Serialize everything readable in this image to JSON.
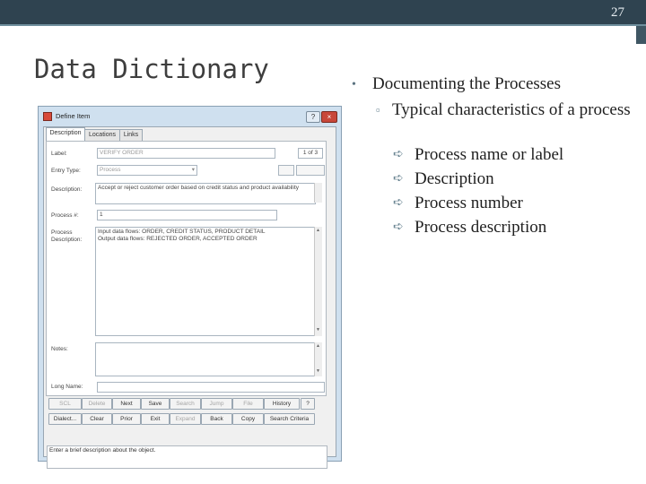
{
  "slide": {
    "number": "27",
    "title": "Data Dictionary"
  },
  "bullets": {
    "level1": "Documenting the Processes",
    "level2": "Typical characteristics of a process",
    "level3": [
      "Process name or label",
      "Description",
      "Process number",
      "Process description"
    ]
  },
  "window": {
    "title": "Define Item",
    "controls": [
      "?",
      "×"
    ],
    "tabs": [
      "Description",
      "Locations",
      "Links"
    ],
    "label_caption": "Label:",
    "label_value": "VERIFY ORDER",
    "record_counter": "1 of 3",
    "entry_type_caption": "Entry Type:",
    "entry_type_value": "Process",
    "description_caption": "Description:",
    "description_value": "Accept or reject customer order based on credit status and product availability",
    "process_num_caption": "Process #:",
    "process_num_value": "1",
    "process_desc_caption": "Process Description:",
    "process_desc_line1": "Input data flows:    ORDER, CREDIT STATUS, PRODUCT DETAIL",
    "process_desc_line2": "Output data flows:  REJECTED ORDER, ACCEPTED ORDER",
    "notes_caption": "Notes:",
    "long_name_caption": "Long Name:",
    "buttons_row1": [
      "SCL",
      "Delete",
      "Next",
      "Save",
      "Search",
      "Jump",
      "File",
      "History",
      "?"
    ],
    "buttons_row2": [
      "Dialect...",
      "Clear",
      "Prior",
      "Exit",
      "Expand",
      "Back",
      "Copy",
      "Search Criteria"
    ],
    "status_text": "Enter a brief description about the object."
  }
}
